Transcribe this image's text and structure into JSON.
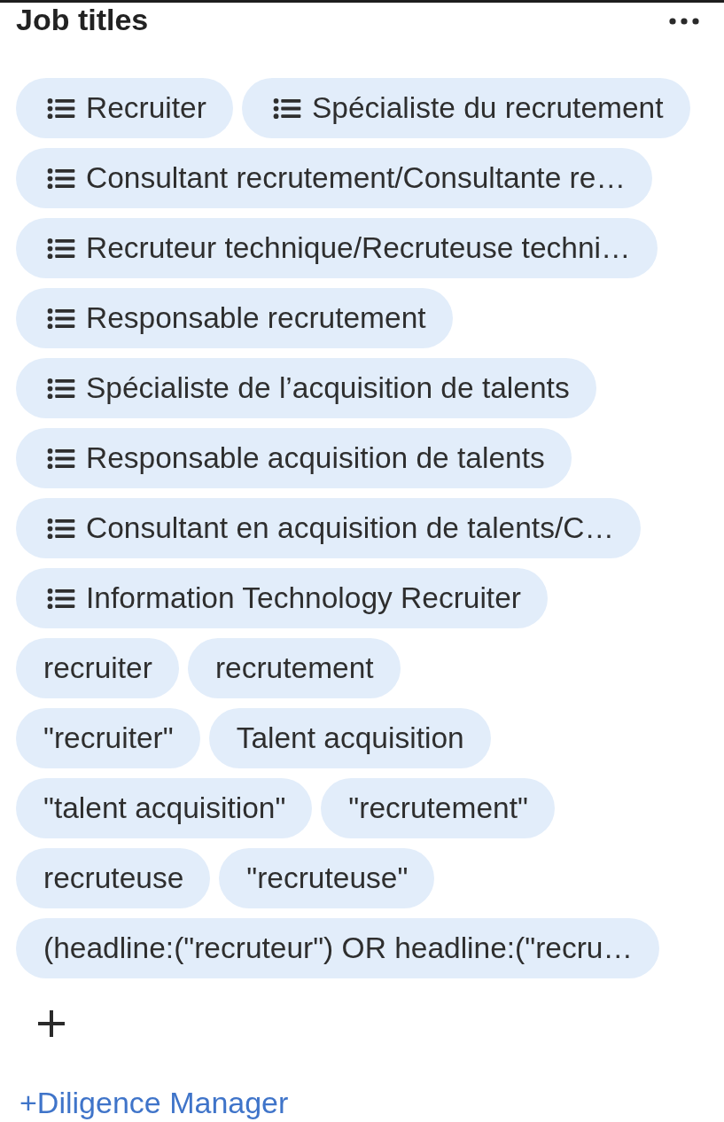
{
  "panel": {
    "title": "Job titles"
  },
  "rows": [
    {
      "tags": [
        {
          "kind": "list",
          "label": "Recruiter"
        },
        {
          "kind": "list",
          "label": "Spécialiste du recrutement"
        }
      ]
    },
    {
      "tags": [
        {
          "kind": "list",
          "label": "Consultant recrutement/Consultante re…"
        }
      ]
    },
    {
      "tags": [
        {
          "kind": "list",
          "label": "Recruteur technique/Recruteuse techni…"
        }
      ]
    },
    {
      "tags": [
        {
          "kind": "list",
          "label": "Responsable recrutement"
        }
      ]
    },
    {
      "tags": [
        {
          "kind": "list",
          "label": "Spécialiste de l’acquisition de talents"
        }
      ]
    },
    {
      "tags": [
        {
          "kind": "list",
          "label": "Responsable acquisition de talents"
        }
      ]
    },
    {
      "tags": [
        {
          "kind": "list",
          "label": "Consultant en acquisition de talents/C…"
        }
      ]
    },
    {
      "tags": [
        {
          "kind": "list",
          "label": "Information Technology Recruiter"
        }
      ]
    },
    {
      "tags": [
        {
          "kind": "text",
          "label": "recruiter"
        },
        {
          "kind": "text",
          "label": "recrutement"
        }
      ]
    },
    {
      "tags": [
        {
          "kind": "text",
          "label": "\"recruiter\""
        },
        {
          "kind": "text",
          "label": "Talent acquisition"
        }
      ]
    },
    {
      "tags": [
        {
          "kind": "text",
          "label": "\"talent acquisition\""
        },
        {
          "kind": "text",
          "label": "\"recrutement\""
        }
      ]
    },
    {
      "tags": [
        {
          "kind": "text",
          "label": "recruteuse"
        },
        {
          "kind": "text",
          "label": "\"recruteuse\""
        }
      ]
    },
    {
      "tags": [
        {
          "kind": "text",
          "label": "(headline:(\"recruteur\") OR headline:(\"recru…"
        }
      ]
    }
  ],
  "link": "+Diligence Manager"
}
